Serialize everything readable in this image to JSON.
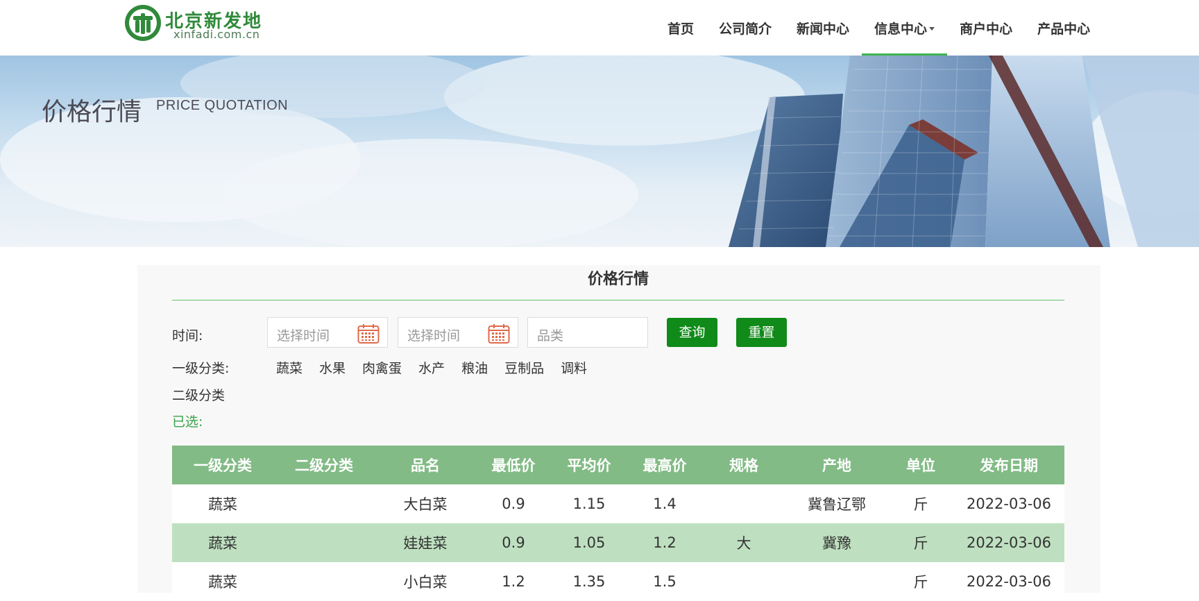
{
  "header": {
    "logo_cn": "北京新发地",
    "logo_en": "xinfadi.com.cn",
    "nav": [
      {
        "label": "首页"
      },
      {
        "label": "公司简介"
      },
      {
        "label": "新闻中心"
      },
      {
        "label": "信息中心",
        "dropdown": true,
        "active": true
      },
      {
        "label": "商户中心"
      },
      {
        "label": "产品中心"
      }
    ],
    "accent_color": "#3fb450"
  },
  "banner": {
    "title": "价格行情",
    "subtitle": "PRICE QUOTATION"
  },
  "panel": {
    "title": "价格行情",
    "filters": {
      "time_label": "时间:",
      "start_placeholder": "选择时间",
      "end_placeholder": "选择时间",
      "kind_placeholder": "品类",
      "query_label": "查询",
      "reset_label": "重置",
      "cat1_label": "一级分类:",
      "cat1_items": [
        "蔬菜",
        "水果",
        "肉禽蛋",
        "水产",
        "粮油",
        "豆制品",
        "调料"
      ],
      "cat2_label": "二级分类",
      "selected_label": "已选:"
    },
    "table": {
      "headers": [
        "一级分类",
        "二级分类",
        "品名",
        "最低价",
        "平均价",
        "最高价",
        "规格",
        "产地",
        "单位",
        "发布日期"
      ],
      "rows": [
        [
          "蔬菜",
          "",
          "大白菜",
          "0.9",
          "1.15",
          "1.4",
          "",
          "冀鲁辽鄂",
          "斤",
          "2022-03-06"
        ],
        [
          "蔬菜",
          "",
          "娃娃菜",
          "0.9",
          "1.05",
          "1.2",
          "大",
          "冀豫",
          "斤",
          "2022-03-06"
        ],
        [
          "蔬菜",
          "",
          "小白菜",
          "1.2",
          "1.35",
          "1.5",
          "",
          "",
          "斤",
          "2022-03-06"
        ]
      ]
    }
  },
  "colors": {
    "table_header_bg": "#82bb85",
    "row_alt_bg": "#bee0c0",
    "button_bg": "#108a19"
  }
}
